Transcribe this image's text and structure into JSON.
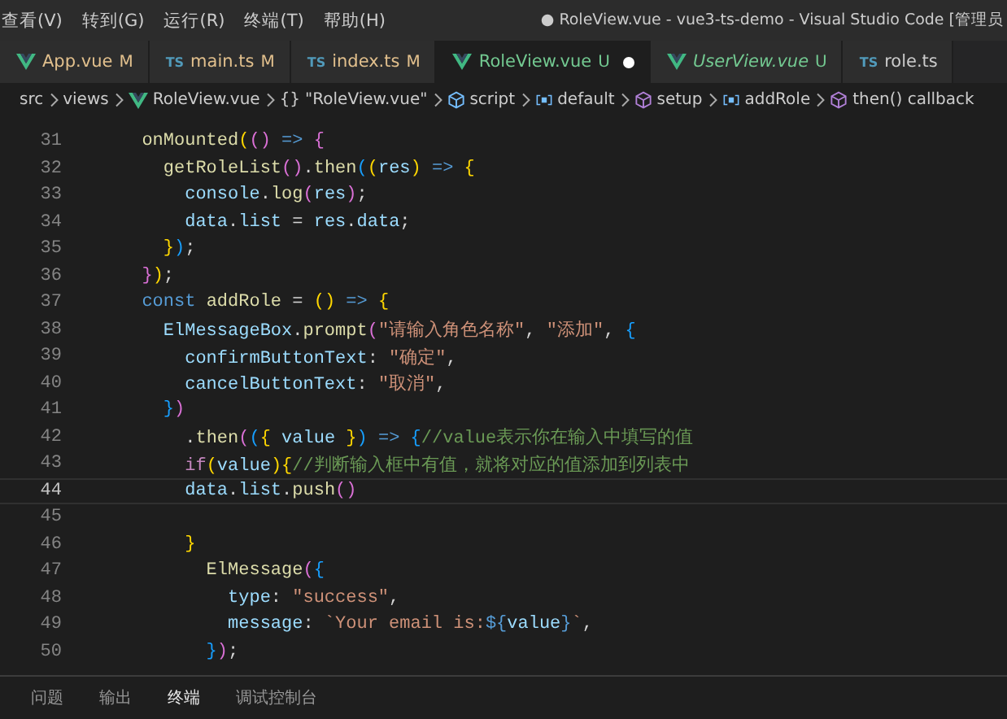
{
  "menu": [
    "查看(V)",
    "转到(G)",
    "运行(R)",
    "终端(T)",
    "帮助(H)"
  ],
  "window": {
    "title": "● RoleView.vue - vue3-ts-demo - Visual Studio Code [管理员"
  },
  "tabs": [
    {
      "label": "App.vue",
      "kind": "vue",
      "status": "M",
      "selected": false,
      "italic": false,
      "modified": false
    },
    {
      "label": "main.ts",
      "kind": "ts",
      "icon_text": "TS",
      "status": "M",
      "selected": false,
      "italic": false,
      "modified": false
    },
    {
      "label": "index.ts",
      "kind": "ts",
      "icon_text": "TS",
      "status": "M",
      "selected": false,
      "italic": false,
      "modified": false
    },
    {
      "label": "RoleView.vue",
      "kind": "vue",
      "status": "U",
      "selected": true,
      "italic": false,
      "modified": true
    },
    {
      "label": "UserView.vue",
      "kind": "vue",
      "status": "U",
      "selected": false,
      "italic": true,
      "modified": false
    },
    {
      "label": "role.ts",
      "kind": "ts",
      "icon_text": "TS",
      "selected": false,
      "italic": false,
      "modified": false
    }
  ],
  "breadcrumbs": [
    {
      "label": "src",
      "kind": "folder"
    },
    {
      "label": "views",
      "kind": "folder"
    },
    {
      "label": "RoleView.vue",
      "kind": "vue"
    },
    {
      "label": "\"RoleView.vue\"",
      "kind": "braces",
      "icon_text": "{}"
    },
    {
      "label": "script",
      "kind": "cube-blue"
    },
    {
      "label": "default",
      "kind": "ref"
    },
    {
      "label": "setup",
      "kind": "cube"
    },
    {
      "label": "addRole",
      "kind": "ref"
    },
    {
      "label": "then() callback",
      "kind": "cube"
    }
  ],
  "lines": [
    {
      "number": "31",
      "current": false,
      "tokens": [
        {
          "text": "  onMounted",
          "kind": "fn"
        },
        {
          "text": "(",
          "kind": "br1"
        },
        {
          "text": "()",
          "kind": "br2"
        },
        {
          "text": " => ",
          "kind": "kw"
        },
        {
          "text": "{",
          "kind": "br2"
        }
      ]
    },
    {
      "number": "32",
      "current": false,
      "tokens": [
        {
          "text": "    getRoleList",
          "kind": "fn"
        },
        {
          "text": "()",
          "kind": "br2"
        },
        {
          "text": ".",
          "kind": "punc"
        },
        {
          "text": "then",
          "kind": "fn"
        },
        {
          "text": "(",
          "kind": "br3"
        },
        {
          "text": "(",
          "kind": "br1"
        },
        {
          "text": "res",
          "kind": "var"
        },
        {
          "text": ")",
          "kind": "br1"
        },
        {
          "text": " => ",
          "kind": "kw"
        },
        {
          "text": "{",
          "kind": "br1"
        }
      ]
    },
    {
      "number": "33",
      "current": false,
      "tokens": [
        {
          "text": "      console",
          "kind": "var"
        },
        {
          "text": ".",
          "kind": "punc"
        },
        {
          "text": "log",
          "kind": "fn"
        },
        {
          "text": "(",
          "kind": "br2"
        },
        {
          "text": "res",
          "kind": "var"
        },
        {
          "text": ")",
          "kind": "br2"
        },
        {
          "text": ";",
          "kind": "punc"
        }
      ]
    },
    {
      "number": "34",
      "current": false,
      "tokens": [
        {
          "text": "      data",
          "kind": "var"
        },
        {
          "text": ".",
          "kind": "punc"
        },
        {
          "text": "list",
          "kind": "var"
        },
        {
          "text": " = ",
          "kind": "punc"
        },
        {
          "text": "res",
          "kind": "var"
        },
        {
          "text": ".",
          "kind": "punc"
        },
        {
          "text": "data",
          "kind": "var"
        },
        {
          "text": ";",
          "kind": "punc"
        }
      ]
    },
    {
      "number": "35",
      "current": false,
      "tokens": [
        {
          "text": "    }",
          "kind": "br1"
        },
        {
          "text": ")",
          "kind": "br3"
        },
        {
          "text": ";",
          "kind": "punc"
        }
      ]
    },
    {
      "number": "36",
      "current": false,
      "tokens": [
        {
          "text": "  }",
          "kind": "br2"
        },
        {
          "text": ")",
          "kind": "br1"
        },
        {
          "text": ";",
          "kind": "punc"
        }
      ]
    },
    {
      "number": "37",
      "current": false,
      "tokens": [
        {
          "text": "  const",
          "kind": "kw"
        },
        {
          "text": " addRole",
          "kind": "fn"
        },
        {
          "text": " = ",
          "kind": "punc"
        },
        {
          "text": "()",
          "kind": "br1"
        },
        {
          "text": " => ",
          "kind": "kw"
        },
        {
          "text": "{",
          "kind": "br1"
        }
      ]
    },
    {
      "number": "38",
      "current": false,
      "tokens": [
        {
          "text": "    ElMessageBox",
          "kind": "var"
        },
        {
          "text": ".",
          "kind": "punc"
        },
        {
          "text": "prompt",
          "kind": "fn"
        },
        {
          "text": "(",
          "kind": "br2"
        },
        {
          "text": "\"请输入角色名称\"",
          "kind": "str"
        },
        {
          "text": ", ",
          "kind": "punc"
        },
        {
          "text": "\"添加\"",
          "kind": "str"
        },
        {
          "text": ", ",
          "kind": "punc"
        },
        {
          "text": "{",
          "kind": "br3"
        }
      ]
    },
    {
      "number": "39",
      "current": false,
      "tokens": [
        {
          "text": "      confirmButtonText",
          "kind": "var"
        },
        {
          "text": ": ",
          "kind": "punc"
        },
        {
          "text": "\"确定\"",
          "kind": "str"
        },
        {
          "text": ",",
          "kind": "punc"
        }
      ]
    },
    {
      "number": "40",
      "current": false,
      "tokens": [
        {
          "text": "      cancelButtonText",
          "kind": "var"
        },
        {
          "text": ": ",
          "kind": "punc"
        },
        {
          "text": "\"取消\"",
          "kind": "str"
        },
        {
          "text": ",",
          "kind": "punc"
        }
      ]
    },
    {
      "number": "41",
      "current": false,
      "tokens": [
        {
          "text": "    }",
          "kind": "br3"
        },
        {
          "text": ")",
          "kind": "br2"
        }
      ]
    },
    {
      "number": "42",
      "current": false,
      "tokens": [
        {
          "text": "      .",
          "kind": "punc"
        },
        {
          "text": "then",
          "kind": "fn"
        },
        {
          "text": "(",
          "kind": "br2"
        },
        {
          "text": "(",
          "kind": "br3"
        },
        {
          "text": "{ ",
          "kind": "br1"
        },
        {
          "text": "value",
          "kind": "var"
        },
        {
          "text": " }",
          "kind": "br1"
        },
        {
          "text": ")",
          "kind": "br3"
        },
        {
          "text": " => ",
          "kind": "kw"
        },
        {
          "text": "{",
          "kind": "br3"
        },
        {
          "text": "//value表示你在输入中填写的值",
          "kind": "comment"
        }
      ]
    },
    {
      "number": "43",
      "current": false,
      "tokens": [
        {
          "text": "      if",
          "kind": "ctrl"
        },
        {
          "text": "(",
          "kind": "br1"
        },
        {
          "text": "value",
          "kind": "var"
        },
        {
          "text": ")",
          "kind": "br1"
        },
        {
          "text": "{",
          "kind": "br1"
        },
        {
          "text": "//判断输入框中有值，就将对应的值添加到列表中",
          "kind": "comment"
        }
      ]
    },
    {
      "number": "44",
      "current": true,
      "tokens": [
        {
          "text": "      data",
          "kind": "var"
        },
        {
          "text": ".",
          "kind": "punc"
        },
        {
          "text": "list",
          "kind": "var"
        },
        {
          "text": ".",
          "kind": "punc"
        },
        {
          "text": "push",
          "kind": "fn"
        },
        {
          "text": "()",
          "kind": "br2"
        }
      ]
    },
    {
      "number": "45",
      "current": false
    },
    {
      "number": "46",
      "current": false,
      "tokens": [
        {
          "text": "      }",
          "kind": "br1"
        }
      ]
    },
    {
      "number": "47",
      "current": false,
      "tokens": [
        {
          "text": "        ElMessage",
          "kind": "fn"
        },
        {
          "text": "(",
          "kind": "br2"
        },
        {
          "text": "{",
          "kind": "br3"
        }
      ]
    },
    {
      "number": "48",
      "current": false,
      "tokens": [
        {
          "text": "          type",
          "kind": "var"
        },
        {
          "text": ": ",
          "kind": "punc"
        },
        {
          "text": "\"success\"",
          "kind": "str"
        },
        {
          "text": ",",
          "kind": "punc"
        }
      ]
    },
    {
      "number": "49",
      "current": false,
      "tokens": [
        {
          "text": "          message",
          "kind": "var"
        },
        {
          "text": ": ",
          "kind": "punc"
        },
        {
          "text": "`Your email is:",
          "kind": "str"
        },
        {
          "text": "${",
          "kind": "kw"
        },
        {
          "text": "value",
          "kind": "var"
        },
        {
          "text": "}",
          "kind": "kw"
        },
        {
          "text": "`",
          "kind": "str"
        },
        {
          "text": ",",
          "kind": "punc"
        }
      ]
    },
    {
      "number": "50",
      "current": false,
      "tokens": [
        {
          "text": "        }",
          "kind": "br3"
        },
        {
          "text": ")",
          "kind": "br2"
        },
        {
          "text": ";",
          "kind": "punc"
        }
      ]
    }
  ],
  "panel_tabs": [
    {
      "label": "问题",
      "selected": false
    },
    {
      "label": "输出",
      "selected": false
    },
    {
      "label": "终端",
      "selected": true
    },
    {
      "label": "调试控制台",
      "selected": false
    }
  ]
}
